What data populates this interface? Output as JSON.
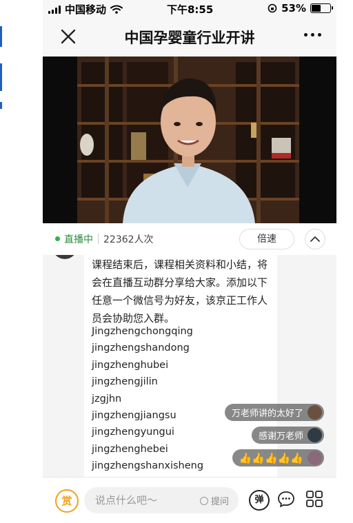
{
  "status_bar": {
    "carrier": "中国移动",
    "time": "下午8:55",
    "battery_pct": "53%",
    "battery_level": 0.53
  },
  "nav": {
    "title": "中国孕婴童行业开讲",
    "close_icon": "close-icon",
    "more_icon": "more-dots-icon"
  },
  "live": {
    "status": "直播中",
    "view_count": "22362人次",
    "speed_label": "倍速",
    "status_color": "#2bb44a"
  },
  "message": {
    "text": "课程结束后，课程相关资料和小结，将会在直播互动群分享给大家。添加以下任意一个微信号为好友，该京正工作人员会协助您入群。",
    "wechat_ids": [
      "Jingzhengchongqing",
      "jingzhengshandong",
      "jingzhenghubei",
      "jingzhengjilin",
      "jzgjhn",
      "jingzhengjiangsu",
      "jingzhengyungui",
      "jingzhenghebei",
      "jingzhengshanxisheng"
    ]
  },
  "comments": [
    {
      "text": "万老师讲的太好了"
    },
    {
      "text": "感谢万老师"
    },
    {
      "text": "👍👍👍👍👍",
      "icon": "thumbs-up-icon"
    }
  ],
  "bottom": {
    "reward_label": "赏",
    "input_placeholder": "说点什么吧～",
    "ask_label": "提问",
    "danmaku_label": "弹",
    "accent": "#f0a21a"
  }
}
